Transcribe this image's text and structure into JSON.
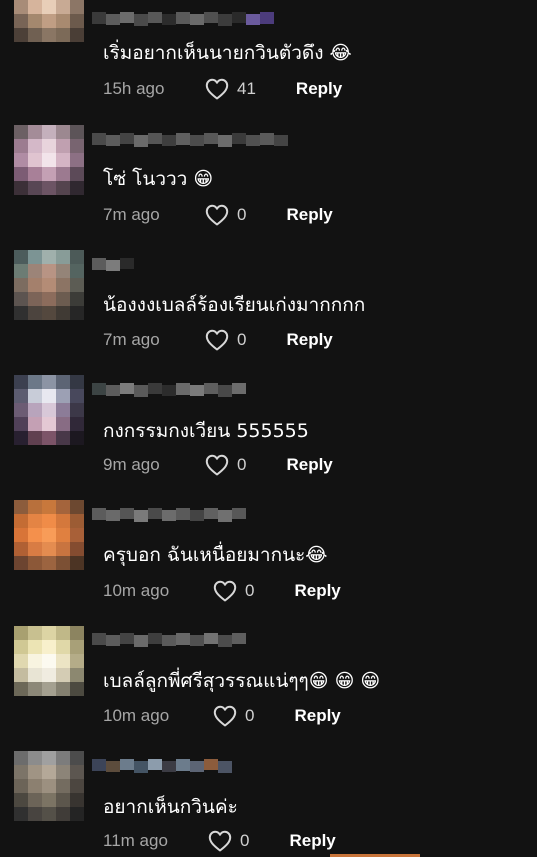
{
  "comments": [
    {
      "text": "เริ่มอยากเห็นนายกวินตัวดึง 😂",
      "time": "15h ago",
      "likes": "41",
      "reply": "Reply"
    },
    {
      "text": "โซ่ โนววว 😁",
      "time": "7m ago",
      "likes": "0",
      "reply": "Reply"
    },
    {
      "text": "น้องงงเบลล์ร้องเรียนเก่งมากกกก",
      "time": "7m ago",
      "likes": "0",
      "reply": "Reply"
    },
    {
      "text": "กงกรรมกงเวียน 555555",
      "time": "9m ago",
      "likes": "0",
      "reply": "Reply"
    },
    {
      "text": "ครุบอก ฉันเหนื่อยมากนะ😂",
      "time": "10m ago",
      "likes": "0",
      "reply": "Reply"
    },
    {
      "text": "เบลล์ลูกพี่ศรีสุวรรณแน่ๆๆ😁 😁 😁",
      "time": "10m ago",
      "likes": "0",
      "reply": "Reply"
    },
    {
      "text": "อยากเห็นกวินค่ะ",
      "time": "11m ago",
      "likes": "0",
      "reply": "Reply"
    }
  ],
  "icons": {
    "like": "heart-outline-icon"
  },
  "colors": {
    "background": "#121212",
    "text": "#ffffff",
    "meta": "#a6a6a6"
  }
}
